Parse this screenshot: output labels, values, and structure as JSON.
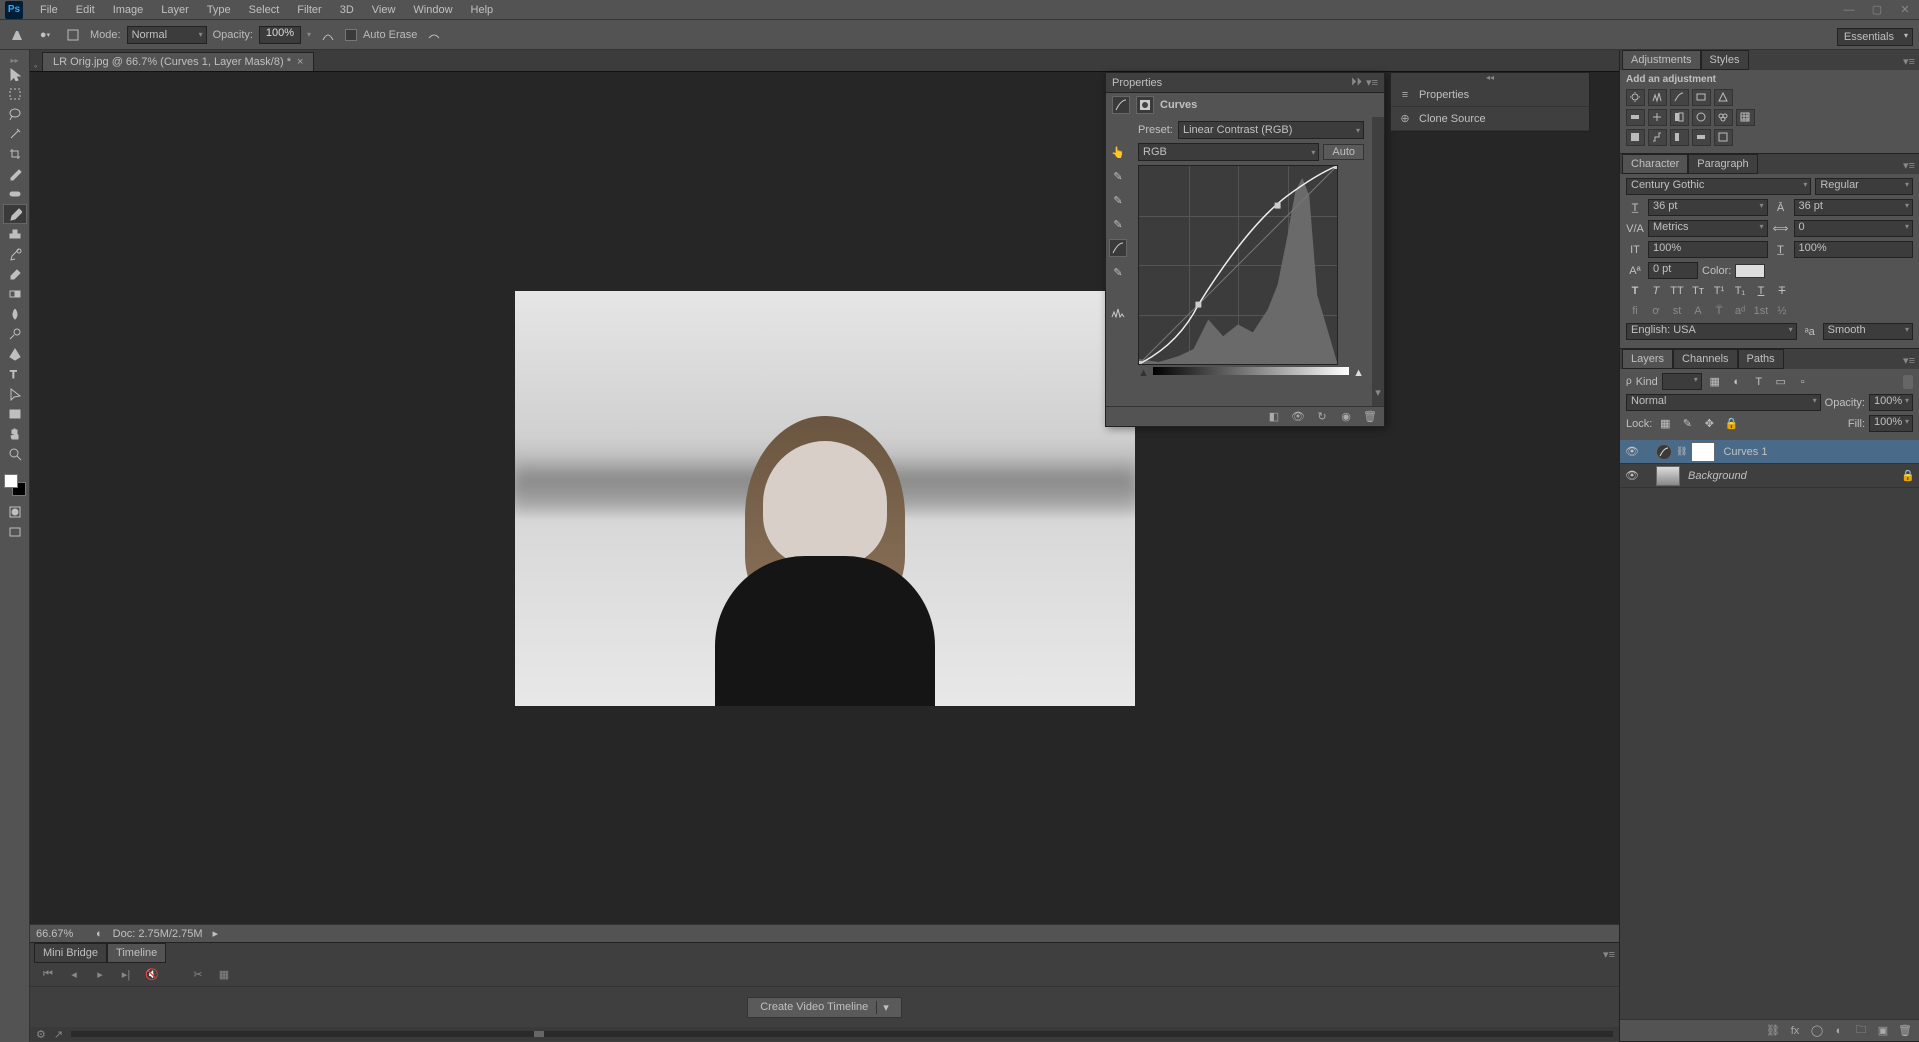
{
  "menu": {
    "items": [
      "File",
      "Edit",
      "Image",
      "Layer",
      "Type",
      "Select",
      "Filter",
      "3D",
      "View",
      "Window",
      "Help"
    ]
  },
  "options": {
    "mode_label": "Mode:",
    "mode_value": "Normal",
    "opacity_label": "Opacity:",
    "opacity_value": "100%",
    "auto_erase": "Auto Erase"
  },
  "workspace": {
    "label": "Essentials"
  },
  "doc": {
    "tab_title": "LR Orig.jpg @ 66.7% (Curves 1, Layer Mask/8) *"
  },
  "status": {
    "zoom": "66.67%",
    "doc_info": "Doc: 2.75M/2.75M"
  },
  "bottom": {
    "tabs": [
      "Mini Bridge",
      "Timeline"
    ],
    "create": "Create Video Timeline"
  },
  "properties": {
    "title": "Properties",
    "type": "Curves",
    "preset_label": "Preset:",
    "preset_value": "Linear Contrast (RGB)",
    "channel": "RGB",
    "auto": "Auto"
  },
  "docked": {
    "properties": "Properties",
    "clone": "Clone Source"
  },
  "adjustments": {
    "tabs": [
      "Adjustments",
      "Styles"
    ],
    "add_label": "Add an adjustment"
  },
  "character": {
    "tabs": [
      "Character",
      "Paragraph"
    ],
    "font": "Century Gothic",
    "style": "Regular",
    "size": "36 pt",
    "leading": "36 pt",
    "kerning": "Metrics",
    "tracking": "0",
    "vscale": "100%",
    "hscale": "100%",
    "baseline": "0 pt",
    "color_label": "Color:",
    "lang": "English: USA",
    "aa": "Smooth"
  },
  "layers": {
    "tabs": [
      "Layers",
      "Channels",
      "Paths"
    ],
    "kind_label": "Kind",
    "blend": "Normal",
    "opacity_label": "Opacity:",
    "opacity": "100%",
    "lock_label": "Lock:",
    "fill_label": "Fill:",
    "fill": "100%",
    "items": [
      {
        "name": "Curves 1",
        "selected": true,
        "adjustment": true
      },
      {
        "name": "Background",
        "selected": false,
        "locked": true
      }
    ]
  }
}
